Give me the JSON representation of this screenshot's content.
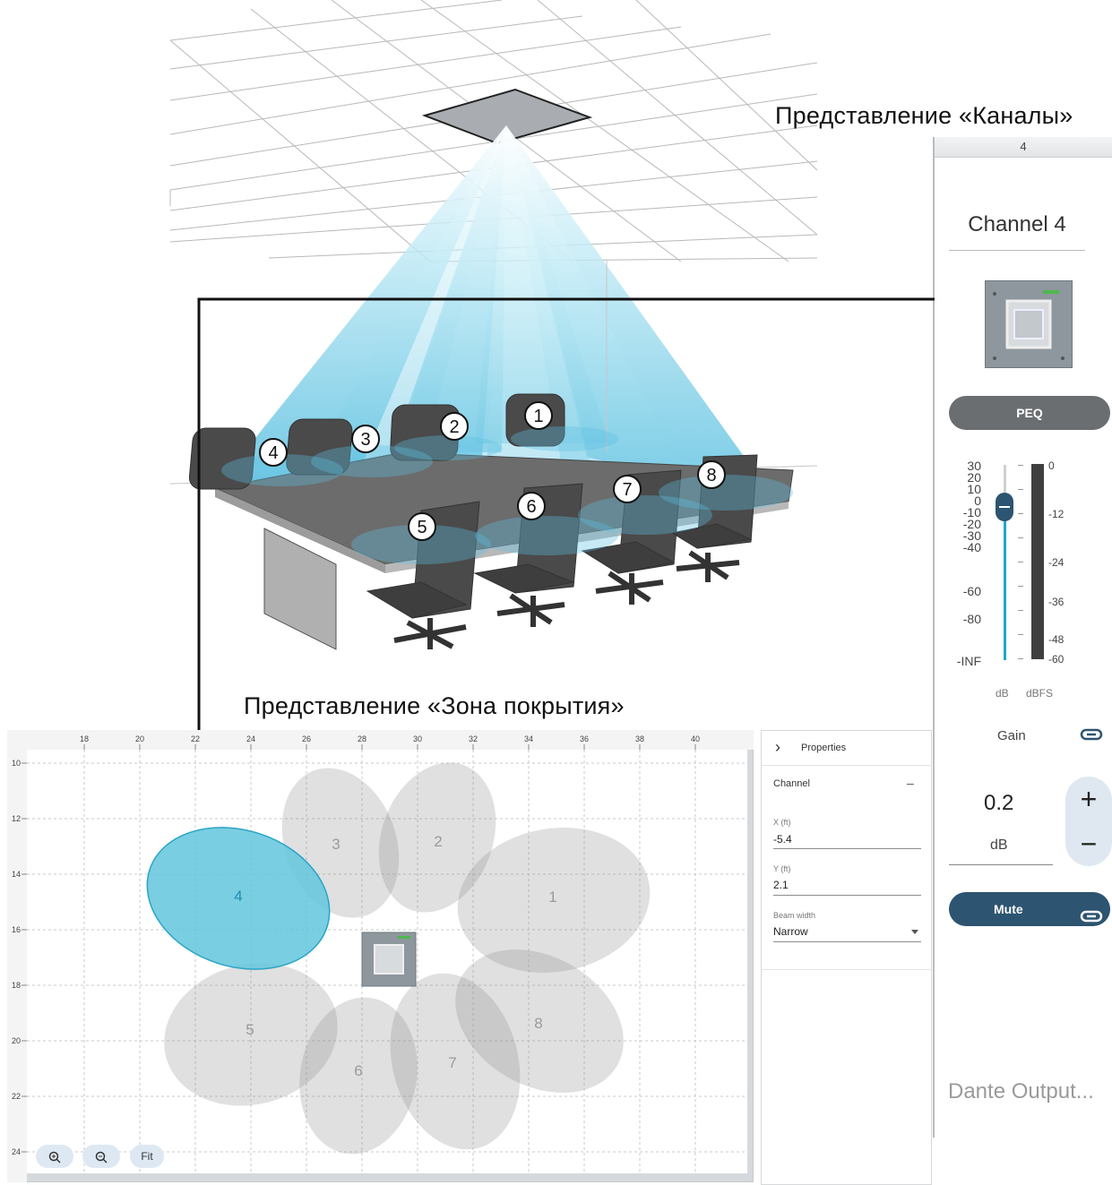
{
  "captions": {
    "channels_view": "Представление «Каналы»",
    "coverage_view": "Представление «Зона покрытия»"
  },
  "illustration": {
    "lobe_markers": [
      "1",
      "2",
      "3",
      "4",
      "5",
      "6",
      "7",
      "8"
    ]
  },
  "channel_strip": {
    "header_number": "4",
    "channel_name": "Channel 4",
    "peq_label": "PEQ",
    "fader_scale": [
      "30",
      "20",
      "10",
      "0",
      "-10",
      "-20",
      "-30",
      "-40",
      "-60",
      "-80",
      "-INF"
    ],
    "meter_scale": [
      "0",
      "-12",
      "-24",
      "-36",
      "-48",
      "-60"
    ],
    "fader_unit": "dB",
    "meter_unit": "dBFS",
    "gain_label": "Gain",
    "gain_value": "0.2",
    "gain_unit": "dB",
    "plus_symbol": "+",
    "minus_symbol": "−",
    "mute_label": "Mute",
    "dante_output_label": "Dante Output...",
    "accent_color": "#1fa8c9",
    "mute_color": "#2d5470"
  },
  "coverage_editor": {
    "x_ruler": [
      "18",
      "20",
      "22",
      "24",
      "26",
      "28",
      "30",
      "32",
      "34",
      "36",
      "38",
      "40"
    ],
    "y_ruler": [
      "10",
      "12",
      "14",
      "16",
      "18",
      "20",
      "22",
      "24"
    ],
    "lobes": [
      {
        "label": "1",
        "selected": false
      },
      {
        "label": "2",
        "selected": false
      },
      {
        "label": "3",
        "selected": false
      },
      {
        "label": "4",
        "selected": true
      },
      {
        "label": "5",
        "selected": false
      },
      {
        "label": "6",
        "selected": false
      },
      {
        "label": "7",
        "selected": false
      },
      {
        "label": "8",
        "selected": false
      }
    ],
    "selected_color": "#62c5dc",
    "zoom_in_label": "zoom-in",
    "zoom_out_label": "zoom-out",
    "fit_label": "Fit"
  },
  "properties_panel": {
    "title": "Properties",
    "collapse_symbol": "›",
    "section": "Channel",
    "section_toggle": "–",
    "x_label": "X (ft)",
    "x_value": "-5.4",
    "y_label": "Y (ft)",
    "y_value": "2.1",
    "beam_label": "Beam width",
    "beam_value": "Narrow"
  }
}
